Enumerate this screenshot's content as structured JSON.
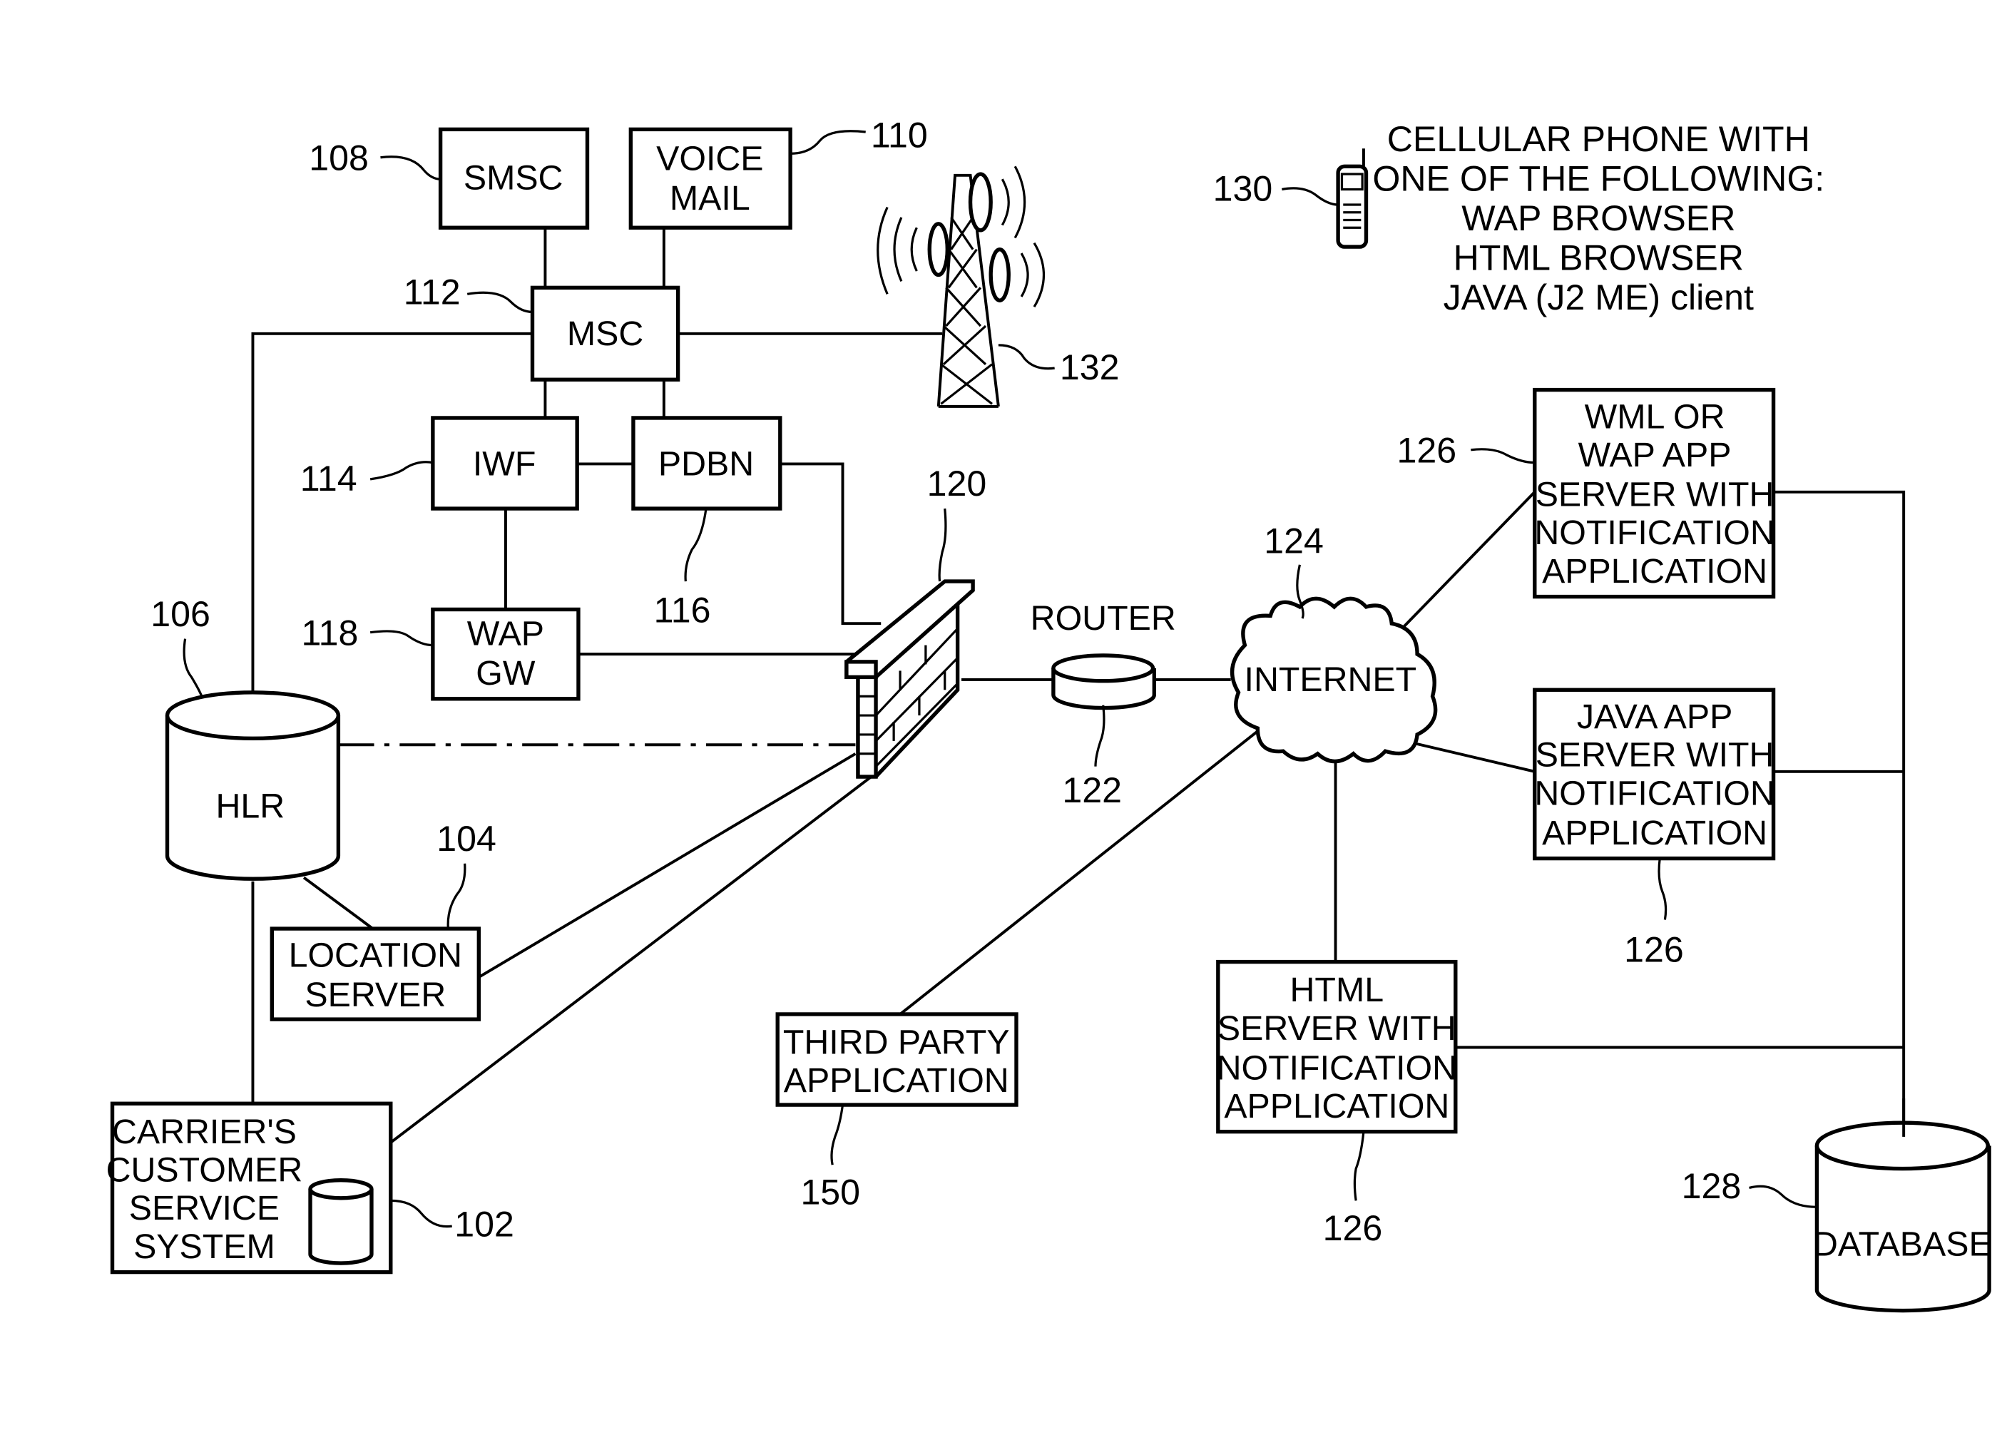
{
  "diagram": {
    "title": "",
    "nodes": {
      "smsc": {
        "ref": "108",
        "lines": [
          "SMSC"
        ]
      },
      "voicemail": {
        "ref": "110",
        "lines": [
          "VOICE",
          "MAIL"
        ]
      },
      "msc": {
        "ref": "112",
        "lines": [
          "MSC"
        ]
      },
      "iwf": {
        "ref": "114",
        "lines": [
          "IWF"
        ]
      },
      "pdbn": {
        "ref": "116",
        "lines": [
          "PDBN"
        ]
      },
      "wapgw": {
        "ref": "118",
        "lines": [
          "WAP",
          "GW"
        ]
      },
      "hlr": {
        "ref": "106",
        "lines": [
          "HLR"
        ]
      },
      "location": {
        "ref": "104",
        "lines": [
          "LOCATION",
          "SERVER"
        ]
      },
      "carrier": {
        "ref": "102",
        "lines": [
          "CARRIER'S",
          "CUSTOMER",
          "SERVICE",
          "SYSTEM"
        ]
      },
      "firewall": {
        "ref": "120"
      },
      "router": {
        "ref": "122",
        "label": "ROUTER"
      },
      "internet": {
        "ref": "124",
        "label": "INTERNET"
      },
      "tower": {
        "ref": "132"
      },
      "phone": {
        "ref": "130"
      },
      "third_party": {
        "ref": "150",
        "lines": [
          "THIRD PARTY",
          "APPLICATION"
        ]
      },
      "wml_server": {
        "ref": "126",
        "lines": [
          "WML OR",
          "WAP APP",
          "SERVER WITH",
          "NOTIFICATION",
          "APPLICATION"
        ]
      },
      "java_server": {
        "ref": "126",
        "lines": [
          "JAVA APP",
          "SERVER WITH",
          "NOTIFICATION",
          "APPLICATION"
        ]
      },
      "html_server": {
        "ref": "126",
        "lines": [
          "HTML",
          "SERVER WITH",
          "NOTIFICATION",
          "APPLICATION"
        ]
      },
      "database": {
        "ref": "128",
        "label": "DATABASE"
      }
    },
    "phone_note": [
      "CELLULAR PHONE WITH",
      "ONE OF THE FOLLOWING:",
      "WAP BROWSER",
      "HTML BROWSER",
      "JAVA (J2 ME) client"
    ]
  }
}
